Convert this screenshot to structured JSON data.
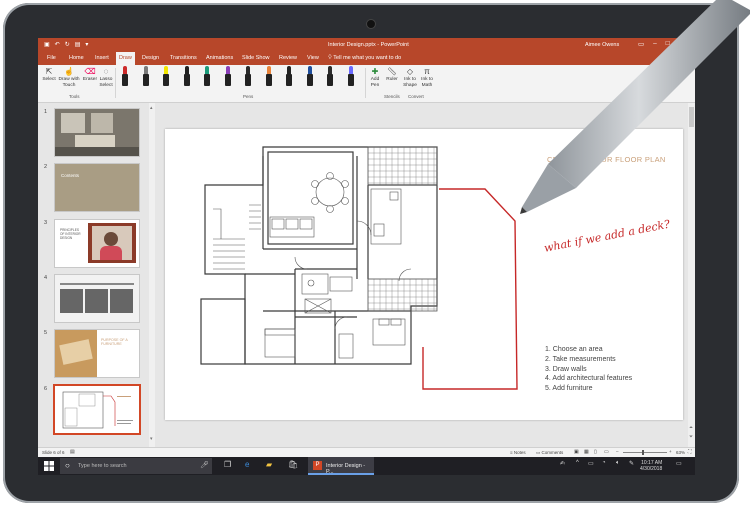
{
  "app": {
    "document_title": "Interior Design.pptx",
    "app_name": "PowerPoint",
    "user_name": "Aimee Owens"
  },
  "tabs": [
    "File",
    "Home",
    "Insert",
    "Draw",
    "Design",
    "Transitions",
    "Animations",
    "Slide Show",
    "Review",
    "View"
  ],
  "active_tab": "Draw",
  "tell_me": "Tell me what you want to do",
  "ribbon": {
    "select": "Select",
    "draw_with_touch": "Draw with Touch",
    "eraser": "Eraser",
    "lasso_select": "Lasso Select",
    "add_pen": "Add Pen",
    "ruler": "Ruler",
    "ink_to_shape": "Ink to Shape",
    "ink_to_math": "Ink to Math",
    "groups": {
      "tools": "Tools",
      "pens": "Pens",
      "stencils": "Stencils",
      "convert": "Convert"
    },
    "pen_colors": [
      "#cc2a2a",
      "#7a7a7a",
      "#f2e600",
      "#202020",
      "#1b9c7a",
      "#8b3fb8",
      "#2a2a2a",
      "#e8823a",
      "#222222",
      "#1f4e9c",
      "#2c2c2c",
      "#6a6aff"
    ]
  },
  "slides": [
    {
      "num": "1"
    },
    {
      "num": "2",
      "text": "Contents"
    },
    {
      "num": "3",
      "text": "PRINCIPLES OF INTERIOR DESIGN"
    },
    {
      "num": "4"
    },
    {
      "num": "5",
      "text": "PURPOSE OF A FURNITURE"
    },
    {
      "num": "6"
    }
  ],
  "slide": {
    "title": "CREATING YOUR FLOOR PLAN",
    "handwritten": "what if we add a deck?",
    "steps": [
      "1. Choose an area",
      "2. Take measurements",
      "3. Draw walls",
      "4. Add architectural features",
      "5. Add furniture"
    ]
  },
  "status": {
    "slide_counter": "Slide 6 of 6",
    "notes": "Notes",
    "comments": "Comments",
    "zoom": "63%"
  },
  "taskbar": {
    "search_placeholder": "Type here to search",
    "ppt_button": "Interior Design - P...",
    "time": "10:17 AM",
    "date": "4/30/2018"
  },
  "colors": {
    "accent": "#b7472a",
    "ink_red": "#c62828",
    "taskbar": "#1f1f24"
  }
}
